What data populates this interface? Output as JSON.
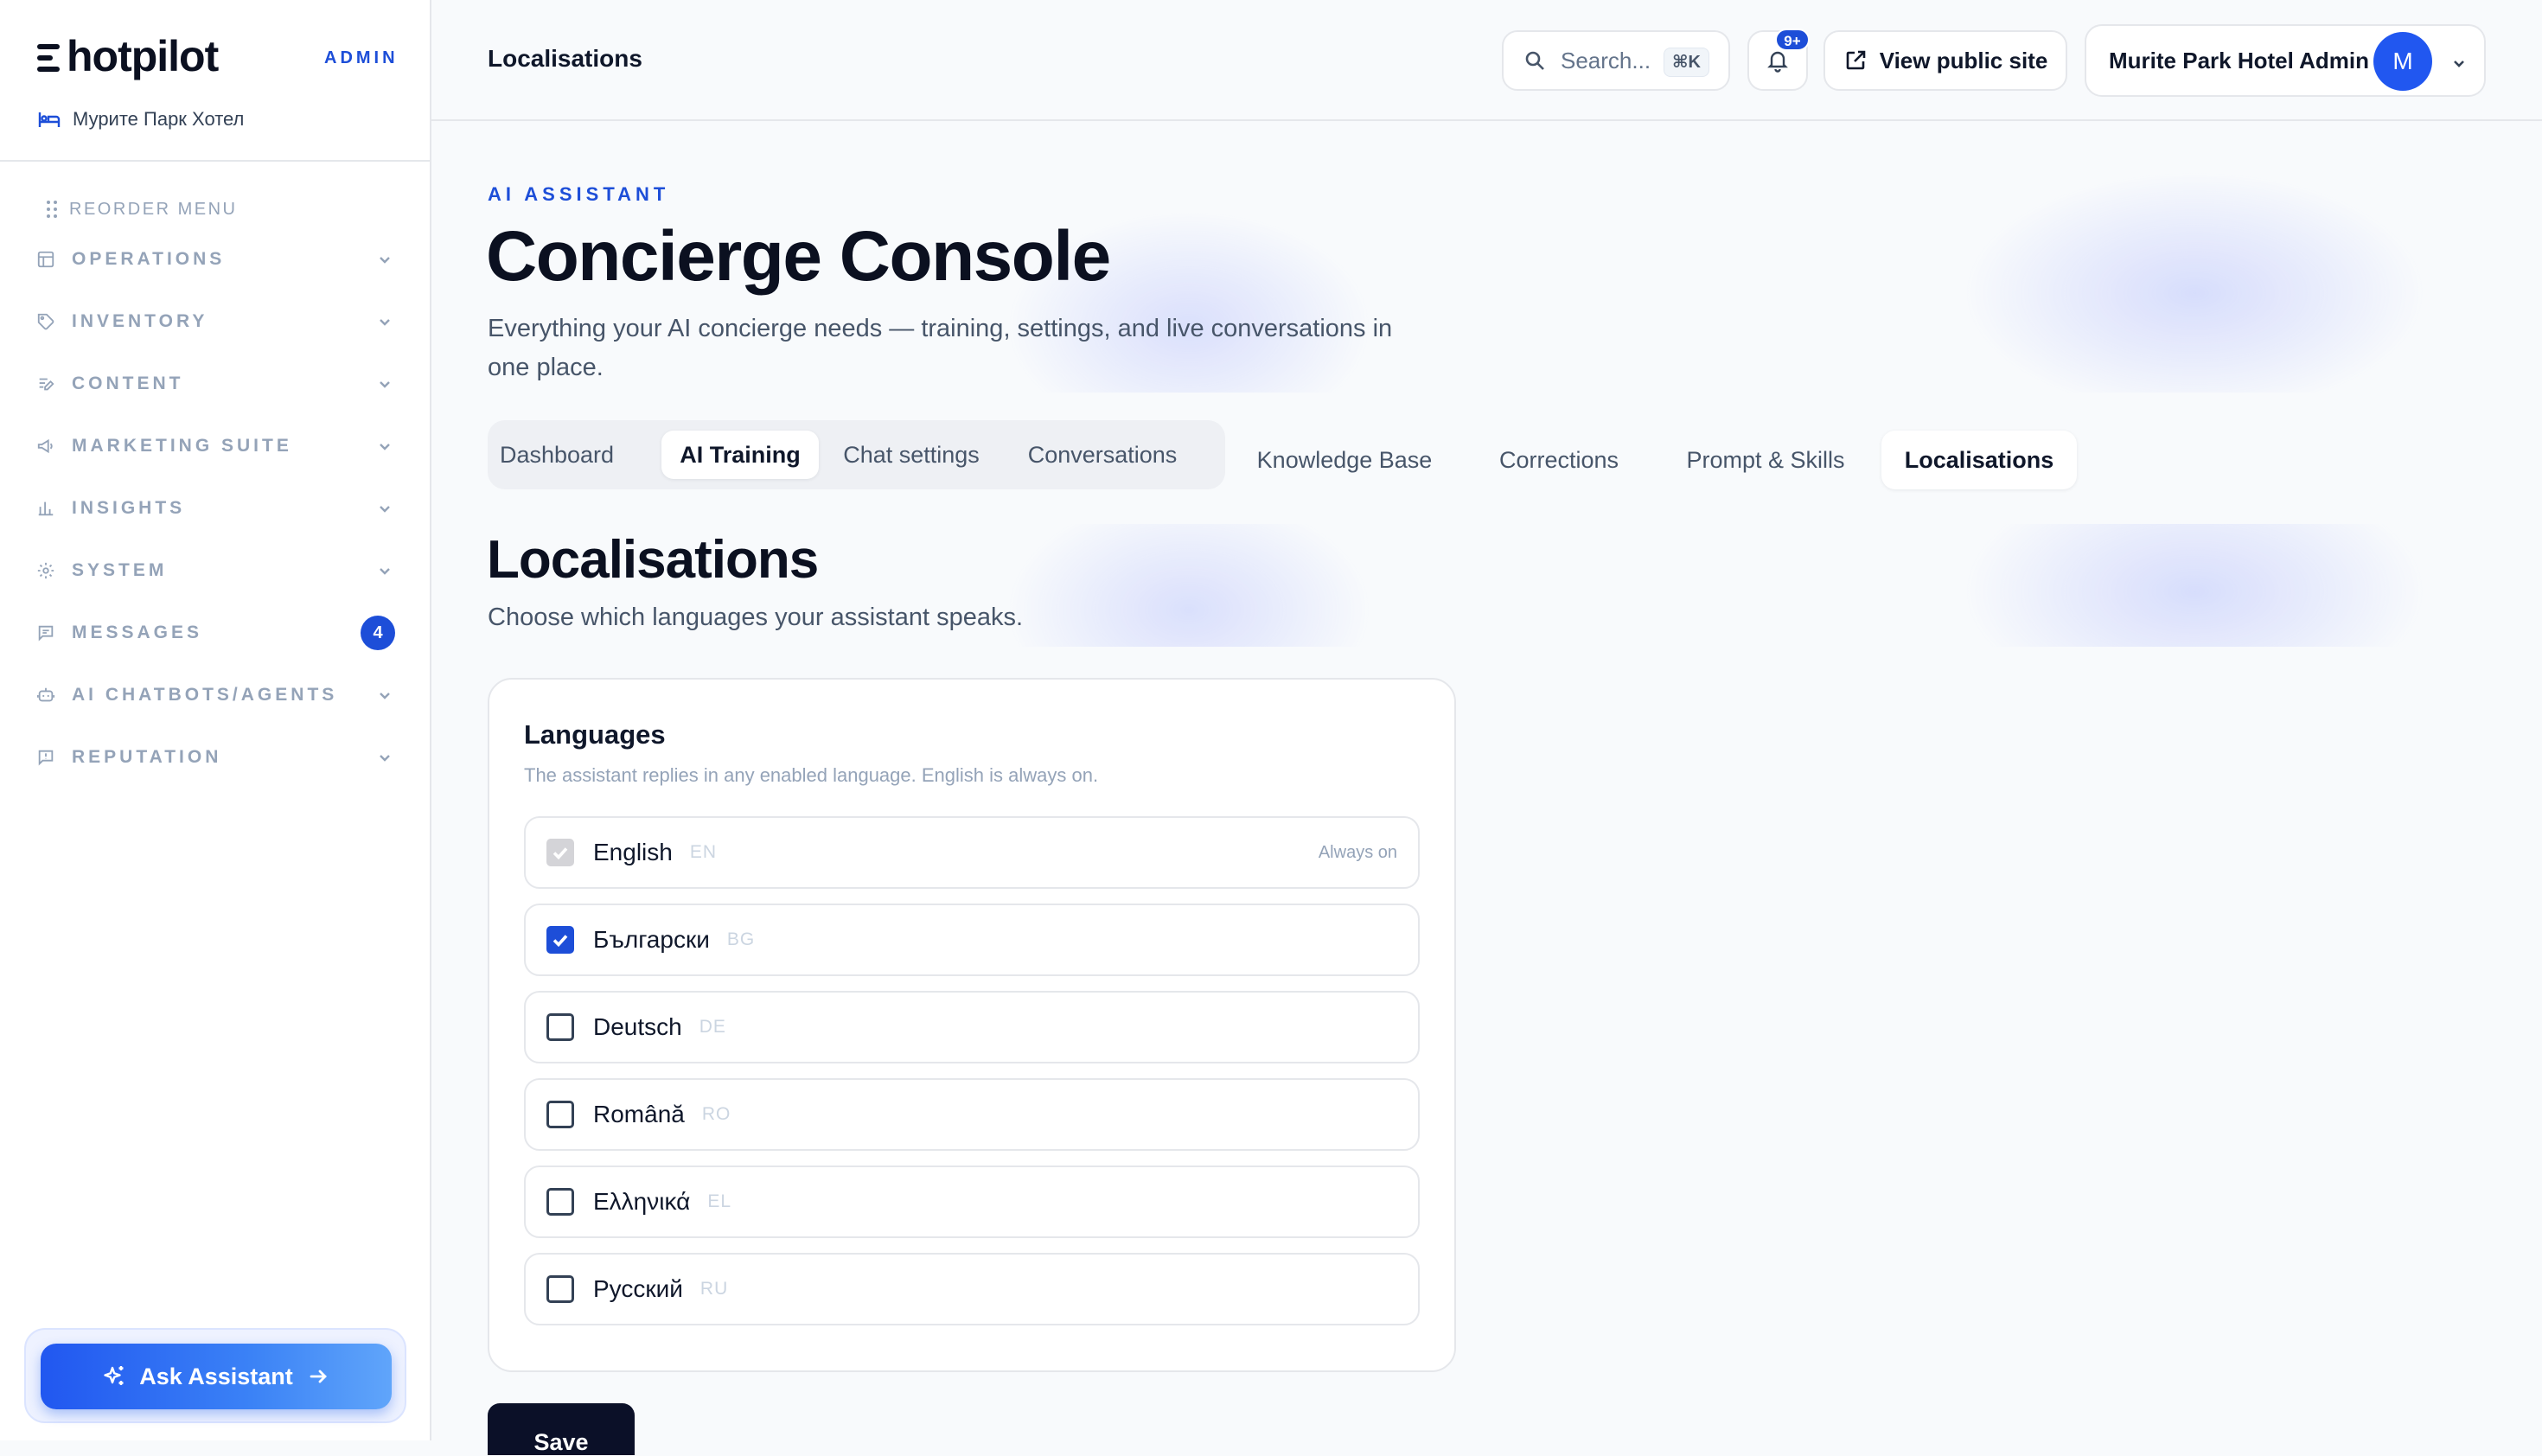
{
  "brand": {
    "logo_text": "hotpilot",
    "admin_tag": "ADMIN",
    "hotel_name": "Мурите Парк Хотел"
  },
  "sidebar": {
    "reorder_label": "REORDER MENU",
    "items": [
      {
        "label": "OPERATIONS",
        "icon": "layout-icon"
      },
      {
        "label": "INVENTORY",
        "icon": "tag-icon"
      },
      {
        "label": "CONTENT",
        "icon": "edit-icon"
      },
      {
        "label": "MARKETING SUITE",
        "icon": "megaphone-icon"
      },
      {
        "label": "INSIGHTS",
        "icon": "bar-chart-icon"
      },
      {
        "label": "SYSTEM",
        "icon": "gear-icon"
      },
      {
        "label": "MESSAGES",
        "icon": "chat-icon",
        "badge": "4"
      },
      {
        "label": "AI CHATBOTS/AGENTS",
        "icon": "bot-icon"
      },
      {
        "label": "REPUTATION",
        "icon": "review-icon"
      }
    ],
    "assistant_button": "Ask Assistant"
  },
  "topbar": {
    "breadcrumb": "Localisations",
    "search_placeholder": "Search...",
    "search_shortcut": "⌘K",
    "notification_badge": "9+",
    "public_site_label": "View public site",
    "user_name": "Murite Park Hotel Admin",
    "avatar_initial": "M"
  },
  "hero": {
    "eyebrow": "AI ASSISTANT",
    "title": "Concierge Console",
    "subtitle": "Everything your AI concierge needs — training, settings, and live conversations in one place."
  },
  "tabs": {
    "group": [
      {
        "label": "Dashboard",
        "active": false
      },
      {
        "label": "AI Training",
        "active": true
      },
      {
        "label": "Chat settings",
        "active": false
      },
      {
        "label": "Conversations",
        "active": false
      }
    ],
    "extra": [
      {
        "label": "Knowledge Base",
        "active": false
      },
      {
        "label": "Corrections",
        "active": false
      },
      {
        "label": "Prompt & Skills",
        "active": false
      },
      {
        "label": "Localisations",
        "active": true
      }
    ]
  },
  "section": {
    "title": "Localisations",
    "subtitle": "Choose which languages your assistant speaks."
  },
  "languages_card": {
    "title": "Languages",
    "subtitle": "The assistant replies in any enabled language. English is always on.",
    "always_on_label": "Always on",
    "languages": [
      {
        "name": "English",
        "code": "EN",
        "checked": true,
        "locked": true
      },
      {
        "name": "Български",
        "code": "BG",
        "checked": true,
        "locked": false
      },
      {
        "name": "Deutsch",
        "code": "DE",
        "checked": false,
        "locked": false
      },
      {
        "name": "Română",
        "code": "RO",
        "checked": false,
        "locked": false
      },
      {
        "name": "Ελληνικά",
        "code": "EL",
        "checked": false,
        "locked": false
      },
      {
        "name": "Русский",
        "code": "RU",
        "checked": false,
        "locked": false
      }
    ]
  },
  "save_label": "Save",
  "colors": {
    "accent": "#1d4ed8",
    "assistant_gradient_start": "#2157f0",
    "assistant_gradient_end": "#60a5fa",
    "save_button": "#0b1028"
  }
}
